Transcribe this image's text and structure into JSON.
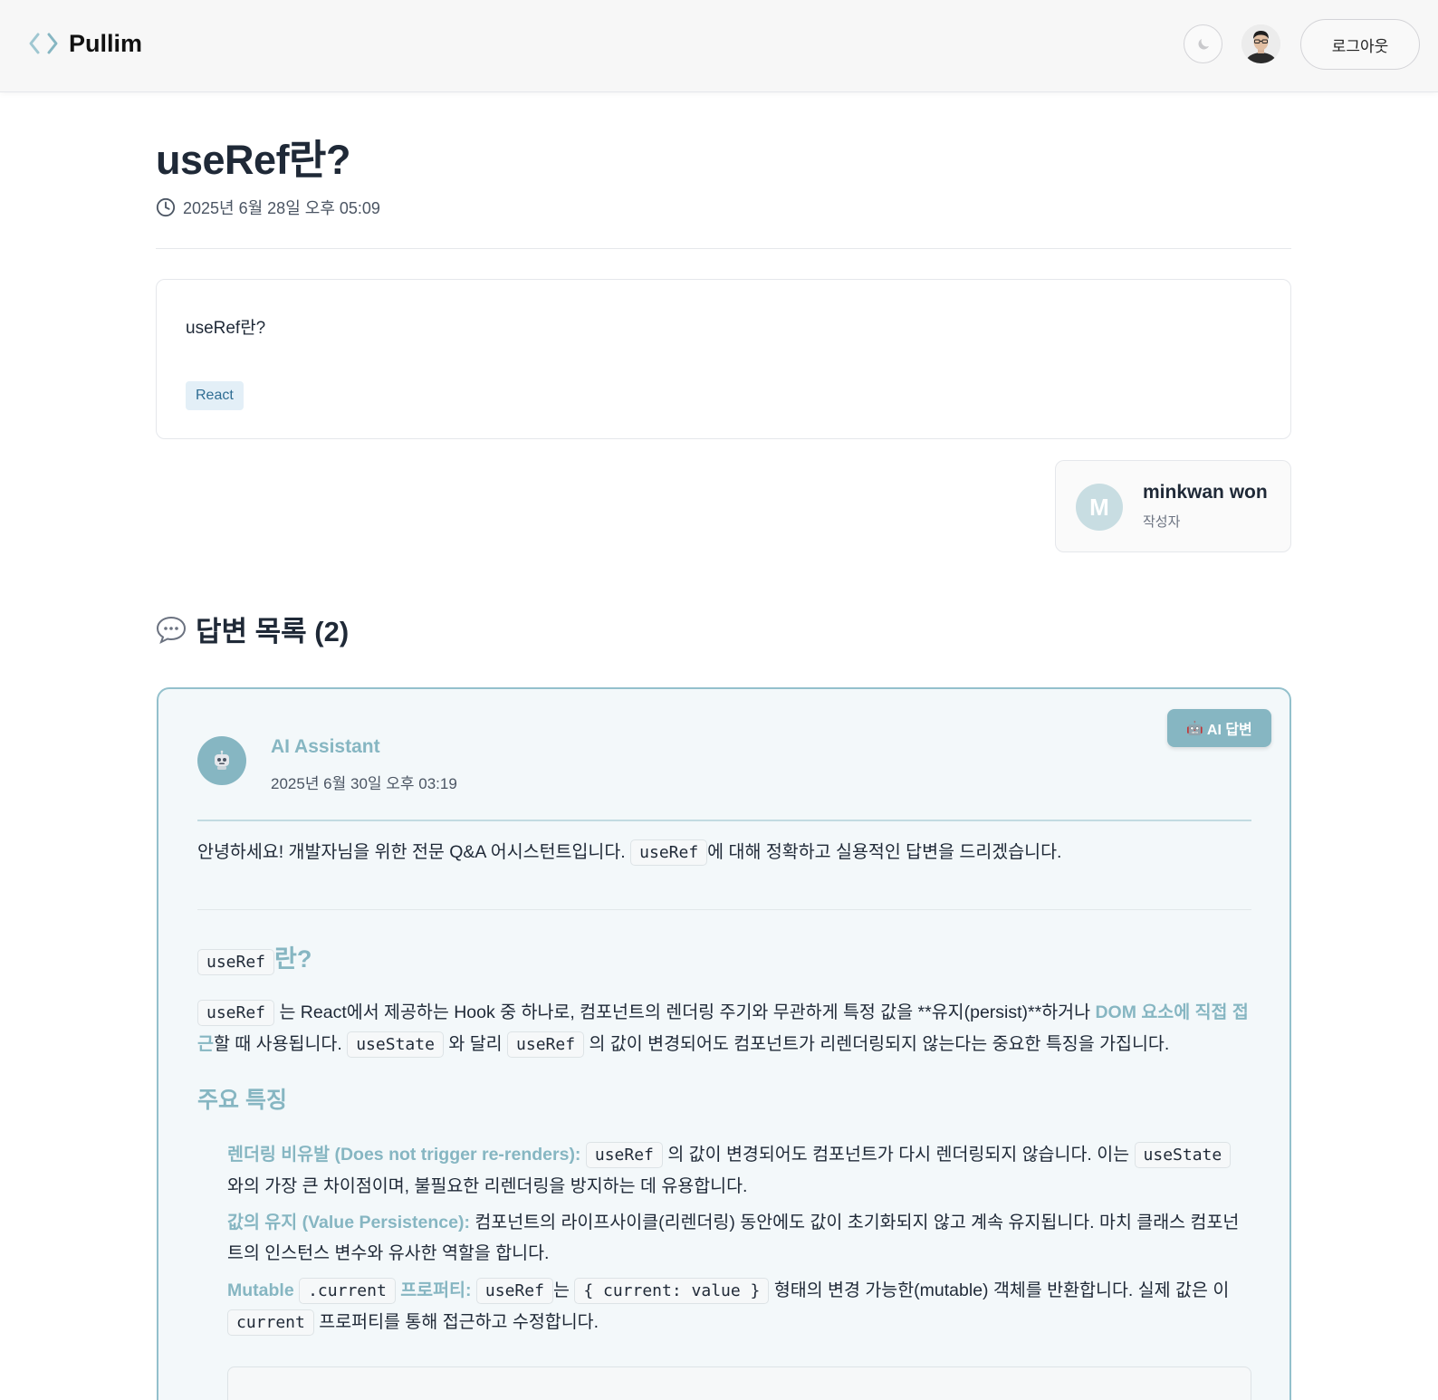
{
  "header": {
    "brand": "Pullim",
    "logout_label": "로그아웃"
  },
  "post": {
    "title": "useRef란?",
    "date": "2025년 6월 28일 오후 05:09",
    "body": "useRef란?",
    "tag": "React"
  },
  "author": {
    "initial": "M",
    "name": "minkwan won",
    "role": "작성자"
  },
  "answers": {
    "heading": "답변 목록 (2)",
    "ai": {
      "badge": "AI 답변",
      "name": "AI Assistant",
      "date": "2025년 6월 30일 오후 03:19",
      "intro_pre": "안녕하세요! 개발자님을 위한 전문 Q&A 어시스턴트입니다.",
      "intro_code": "useRef",
      "intro_post": "에 대해 정확하고 실용적인 답변을 드리겠습니다.",
      "h2_code": "useRef",
      "h2_text": "란?",
      "p1_code1": "useRef",
      "p1_a": "는 React에서 제공하는 Hook 중 하나로, 컴포넌트의 렌더링 주기와 무관하게 특정 값을 **유지(persist)**하거나",
      "p1_accent": "DOM 요소에 직접 접근",
      "p1_b": "할 때 사용됩니다.",
      "p1_code2": "useState",
      "p1_c": "와 달리",
      "p1_code3": "useRef",
      "p1_d": "의 값이 변경되어도 컴포넌트가 리렌더링되지 않는다는 중요한 특징을 가집니다.",
      "h3": "주요 특징",
      "li1_label": "렌더링 비유발 (Does not trigger re-renders):",
      "li1_code1": "useRef",
      "li1_a": "의 값이 변경되어도 컴포넌트가 다시 렌더링되지 않습니다. 이는",
      "li1_code2": "useState",
      "li1_b": "와의 가장 큰 차이점이며, 불필요한 리렌더링을 방지하는 데 유용합니다.",
      "li2_label": "값의 유지 (Value Persistence):",
      "li2_text": "컴포넌트의 라이프사이클(리렌더링) 동안에도 값이 초기화되지 않고 계속 유지됩니다. 마치 클래스 컴포넌트의 인스턴스 변수와 유사한 역할을 합니다.",
      "li3_label1": "Mutable",
      "li3_code1": ".current",
      "li3_label2": "프로퍼티:",
      "li3_code2": "useRef",
      "li3_a": "는",
      "li3_code3": "{ current: value }",
      "li3_b": "형태의 변경 가능한(mutable) 객체를 반환합니다. 실제 값은 이",
      "li3_code4": "current",
      "li3_c": "프로퍼티를 통해 접근하고 수정합니다."
    }
  },
  "colors": {
    "accent": "#86b6c2",
    "border": "#93c0cc",
    "tag_bg": "#e3eff7",
    "tag_text": "#2f6d93"
  }
}
